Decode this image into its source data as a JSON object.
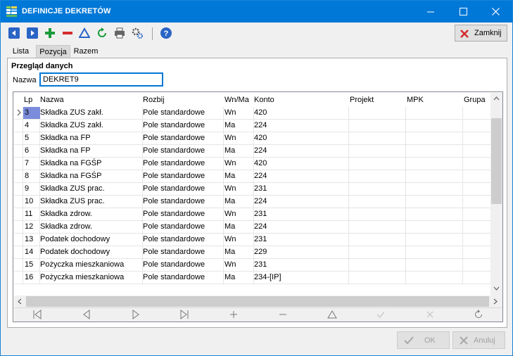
{
  "window": {
    "title": "DEFINICJE DEKRETÓW"
  },
  "toolbar": {
    "close_label": "Zamknij"
  },
  "tabs": [
    "Lista",
    "Pozycja",
    "Razem"
  ],
  "form": {
    "section_title": "Przegląd danych",
    "nazwa_label": "Nazwa",
    "nazwa_value": "DEKRET9"
  },
  "grid": {
    "columns": [
      "Lp",
      "Nazwa",
      "Rozbij",
      "Wn/Ma",
      "Konto",
      "Projekt",
      "MPK",
      "Grupa"
    ],
    "rows": [
      [
        "3",
        "Składka ZUS zakł.",
        "Pole standardowe",
        "Wn",
        "420"
      ],
      [
        "4",
        "Składka ZUS zakł.",
        "Pole standardowe",
        "Ma",
        "224"
      ],
      [
        "5",
        "Składka na FP",
        "Pole standardowe",
        "Wn",
        "420"
      ],
      [
        "6",
        "Składka na FP",
        "Pole standardowe",
        "Ma",
        "224"
      ],
      [
        "7",
        "Składka na FGŚP",
        "Pole standardowe",
        "Wn",
        "420"
      ],
      [
        "8",
        "Składka na FGŚP",
        "Pole standardowe",
        "Ma",
        "224"
      ],
      [
        "9",
        "Składka ZUS prac.",
        "Pole standardowe",
        "Wn",
        "231"
      ],
      [
        "10",
        "Składka ZUS prac.",
        "Pole standardowe",
        "Ma",
        "224"
      ],
      [
        "11",
        "Składka zdrow.",
        "Pole standardowe",
        "Wn",
        "231"
      ],
      [
        "12",
        "Składka zdrow.",
        "Pole standardowe",
        "Ma",
        "224"
      ],
      [
        "13",
        "Podatek dochodowy",
        "Pole standardowe",
        "Wn",
        "231"
      ],
      [
        "14",
        "Podatek dochodowy",
        "Pole standardowe",
        "Ma",
        "229"
      ],
      [
        "15",
        "Pożyczka mieszkaniowa",
        "Pole standardowe",
        "Wn",
        "231"
      ],
      [
        "16",
        "Pożyczka mieszkaniowa",
        "Pole standardowe",
        "Ma",
        "234-[IP]"
      ]
    ]
  },
  "footer": {
    "ok_label": "OK",
    "cancel_label": "Anuluj"
  },
  "colors": {
    "titlebar": "#0078d7",
    "selection": "#7a8cdb",
    "accent_green": "#1a9b3a",
    "accent_red": "#d52b2b"
  }
}
